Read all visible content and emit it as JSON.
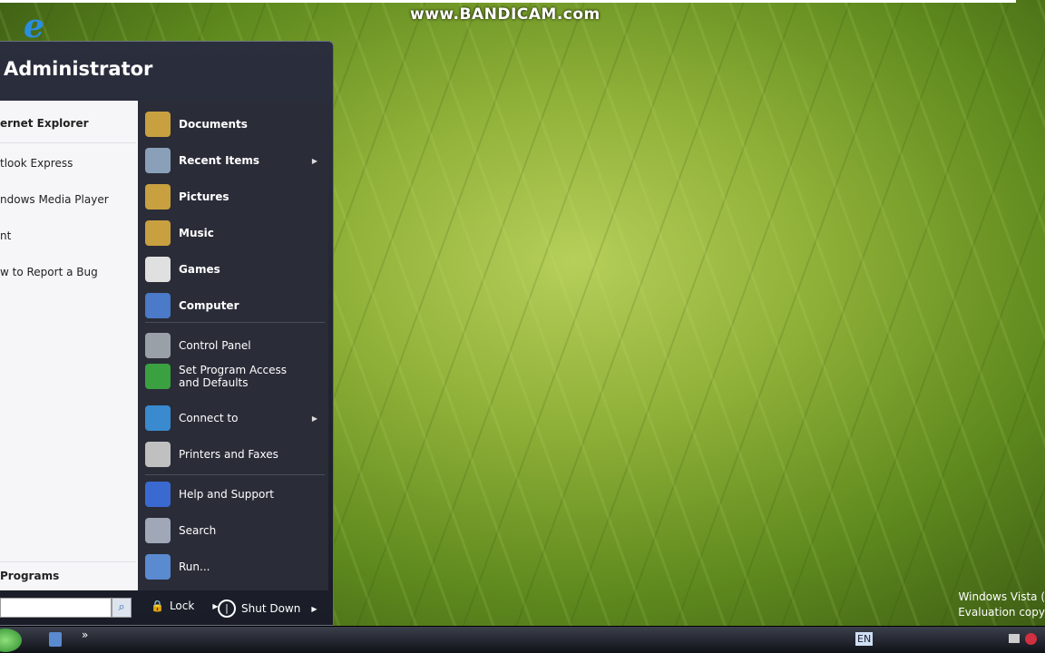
{
  "watermark": "www.BANDICAM.com",
  "vista": {
    "line1": "Windows Vista (",
    "line2": "Evaluation copy"
  },
  "start_menu": {
    "user": "Administrator",
    "left_items": [
      "ernet Explorer",
      "tlook Express",
      "ndows Media Player",
      "nt",
      "w to Report a Bug"
    ],
    "all_programs": "Programs",
    "right_items": [
      {
        "label": "Documents",
        "color": "#c9a040"
      },
      {
        "label": "Recent Items",
        "color": "#8aa0b8",
        "submenu": true
      },
      {
        "label": "Pictures",
        "color": "#c9a040"
      },
      {
        "label": "Music",
        "color": "#c9a040"
      },
      {
        "label": "Games",
        "color": "#e0e0e0"
      },
      {
        "label": "Computer",
        "color": "#4a7ac8"
      },
      {
        "label": "Control Panel",
        "color": "#9aa0a8"
      },
      {
        "label": "Set Program Access and Defaults",
        "color": "#3aa040"
      },
      {
        "label": "Connect to",
        "color": "#3a8ad0",
        "submenu": true
      },
      {
        "label": "Printers and Faxes",
        "color": "#c0c0c0"
      },
      {
        "label": "Help and Support",
        "color": "#3a6ad0"
      },
      {
        "label": "Search",
        "color": "#a0a8b8"
      },
      {
        "label": "Run...",
        "color": "#5a8ad0"
      }
    ],
    "search_placeholder": "",
    "lock": "Lock",
    "shutdown": "Shut Down"
  },
  "taskbar": {
    "language": "EN",
    "more": "»"
  }
}
